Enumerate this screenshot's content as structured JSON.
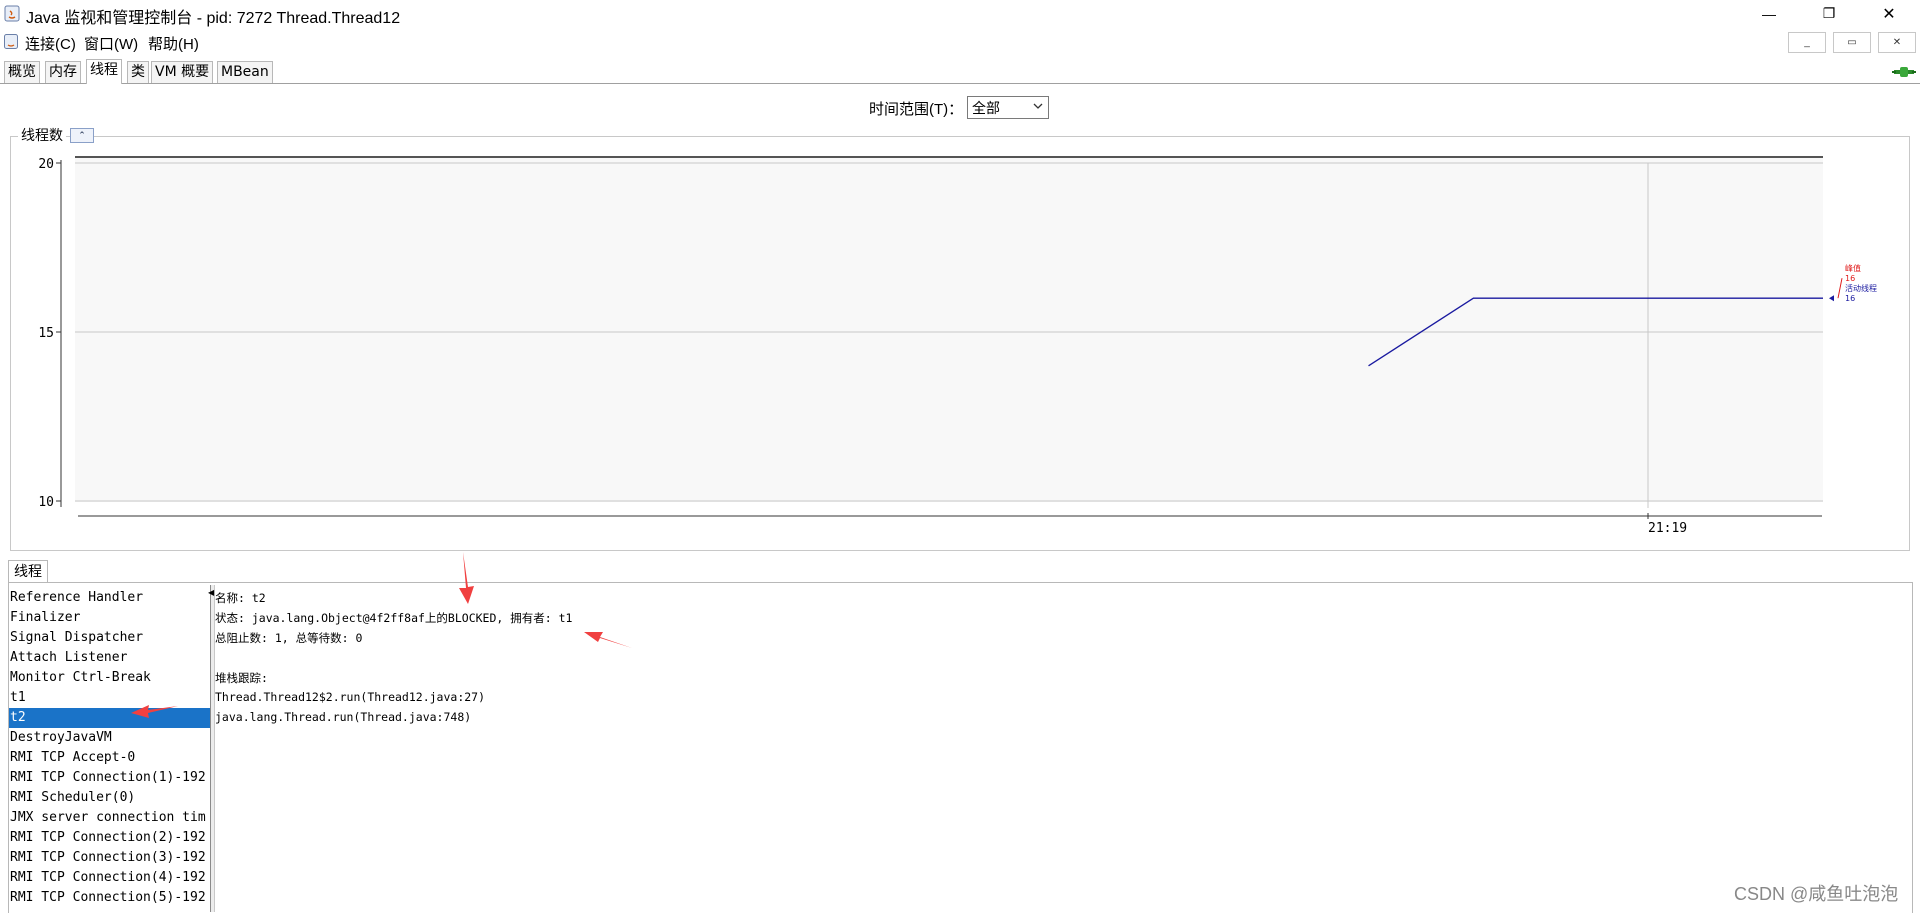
{
  "window": {
    "title": "Java 监视和管理控制台 - pid: 7272 Thread.Thread12",
    "minimize_glyph": "—",
    "maximize_glyph": "❐",
    "close_glyph": "✕"
  },
  "menubar": {
    "items": [
      {
        "label": "连接(C)"
      },
      {
        "label": "窗口(W)"
      },
      {
        "label": "帮助(H)"
      }
    ],
    "mdi_buttons": [
      "_",
      "▭",
      "✕"
    ]
  },
  "tabs": [
    {
      "label": "概览",
      "active": false
    },
    {
      "label": "内存",
      "active": false
    },
    {
      "label": "线程",
      "active": true
    },
    {
      "label": "类",
      "active": false
    },
    {
      "label": "VM 概要",
      "active": false
    },
    {
      "label": "MBean",
      "active": false
    }
  ],
  "time_range": {
    "label": "时间范围(T)：",
    "value": "全部"
  },
  "chart_panel": {
    "title": "线程数",
    "collapse_glyph": "⌃"
  },
  "chart_data": {
    "type": "line",
    "ylim": [
      10,
      20
    ],
    "yticks": [
      "20",
      "15",
      "10"
    ],
    "xticks": [
      "21:19"
    ],
    "series": [
      {
        "name": "峰值",
        "color": "#e01a1a",
        "current": "16"
      },
      {
        "name": "活动线程",
        "color": "#1a1aa0",
        "current": "16",
        "points": [
          {
            "t": 0.74,
            "v": 14
          },
          {
            "t": 0.8,
            "v": 16
          },
          {
            "t": 1.0,
            "v": 16
          }
        ]
      }
    ],
    "grid": true,
    "legend": "right"
  },
  "threads_panel": {
    "tab_label": "线程",
    "threads": [
      "Reference Handler",
      "Finalizer",
      "Signal Dispatcher",
      "Attach Listener",
      "Monitor Ctrl-Break",
      "t1",
      "t2",
      "DestroyJavaVM",
      "RMI TCP Accept-0",
      "RMI TCP Connection(1)-192",
      "RMI Scheduler(0)",
      "JMX server connection tim",
      "RMI TCP Connection(2)-192",
      "RMI TCP Connection(3)-192",
      "RMI TCP Connection(4)-192",
      "RMI TCP Connection(5)-192"
    ],
    "selected": "t2"
  },
  "thread_details": {
    "name_line": "名称: t2",
    "state_line": "状态: java.lang.Object@4f2ff8af上的BLOCKED, 拥有者: t1",
    "counts_line": "总阻止数: 1, 总等待数: 0",
    "stack_title": "堆栈跟踪:",
    "stack": [
      "Thread.Thread12$2.run(Thread12.java:27)",
      "java.lang.Thread.run(Thread.java:748)"
    ]
  },
  "watermark": "CSDN @咸鱼吐泡泡",
  "colors": {
    "selection": "#1a73c8",
    "annotation_arrow": "#f04040",
    "active_series": "#1a1aa0",
    "peak_series": "#e01a1a"
  }
}
